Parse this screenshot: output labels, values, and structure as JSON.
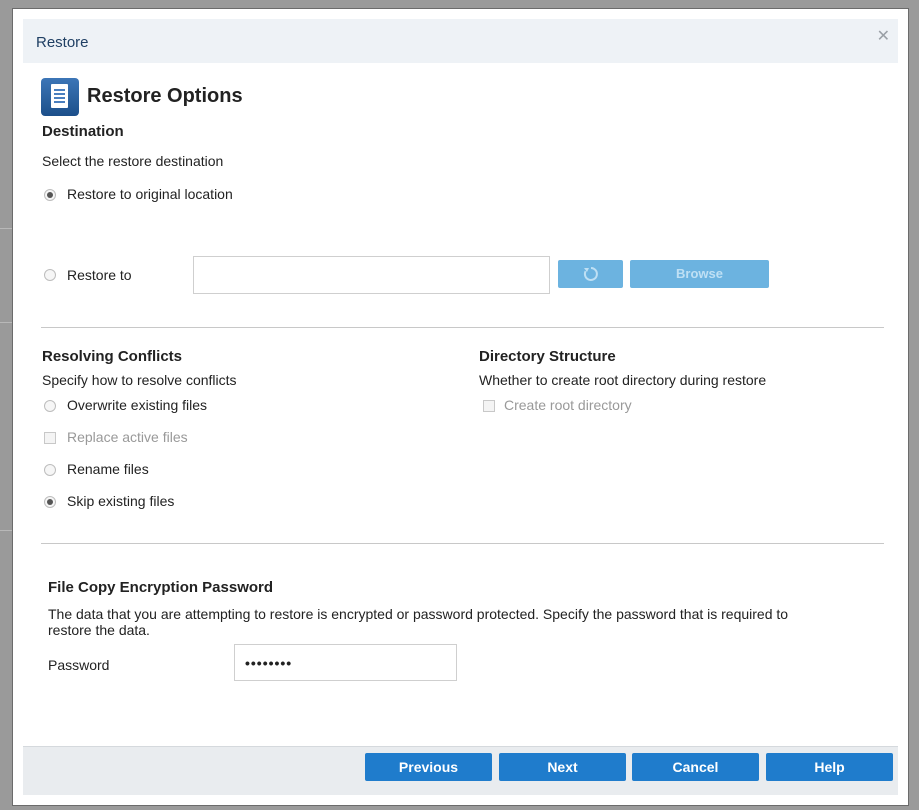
{
  "dialog": {
    "title": "Restore",
    "close_glyph": "✕"
  },
  "page": {
    "icon": "restore-document-icon",
    "title": "Restore Options"
  },
  "destination": {
    "heading": "Destination",
    "description": "Select the restore destination",
    "option_original": "Restore to original location",
    "option_original_selected": true,
    "option_restore_to": "Restore to",
    "option_restore_to_selected": false,
    "path_value": "",
    "refresh_icon": "refresh-icon",
    "browse_label": "Browse"
  },
  "conflicts": {
    "heading": "Resolving Conflicts",
    "description": "Specify how to resolve conflicts",
    "options": [
      {
        "label": "Overwrite existing files",
        "type": "radio",
        "checked": false,
        "enabled": true
      },
      {
        "label": "Replace active files",
        "type": "checkbox",
        "checked": false,
        "enabled": false
      },
      {
        "label": "Rename files",
        "type": "radio",
        "checked": false,
        "enabled": true
      },
      {
        "label": "Skip existing files",
        "type": "radio",
        "checked": true,
        "enabled": true
      }
    ]
  },
  "directory": {
    "heading": "Directory Structure",
    "description": "Whether to create root directory during restore",
    "option_label": "Create root directory",
    "enabled": false,
    "checked": false
  },
  "encryption": {
    "heading": "File Copy Encryption Password",
    "description_line1": "The data that you are attempting to restore is encrypted or password protected. Specify the password that is required to",
    "description_line2": "restore the data.",
    "password_label": "Password",
    "password_value": "••••••••"
  },
  "footer": {
    "previous_label": "Previous",
    "next_label": "Next",
    "cancel_label": "Cancel",
    "help_label": "Help"
  },
  "colors": {
    "primary_button": "#1f7ccc",
    "disabled_button": "#6cb3e0",
    "title_text": "#1f3f63"
  }
}
